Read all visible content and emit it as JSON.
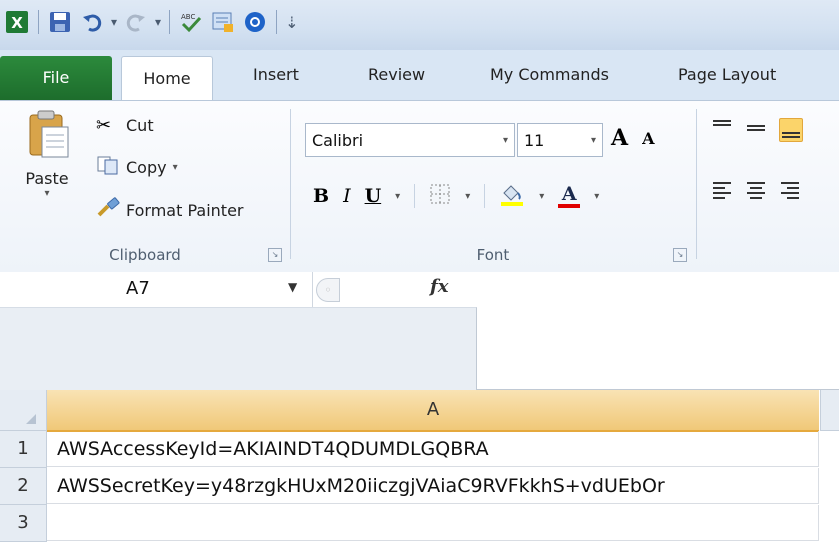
{
  "quick_access": {
    "icons": [
      "excel-icon",
      "save-icon",
      "undo-icon",
      "redo-icon",
      "spelling-icon",
      "form-icon",
      "record-icon",
      "customize-qat-icon"
    ]
  },
  "tabs": [
    "File",
    "Home",
    "Insert",
    "Review",
    "My Commands",
    "Page Layout"
  ],
  "clipboard": {
    "paste_label": "Paste",
    "cut_label": "Cut",
    "copy_label": "Copy",
    "format_painter_label": "Format Painter",
    "group_label": "Clipboard"
  },
  "font": {
    "name": "Calibri",
    "size": "11",
    "grow_label": "A",
    "shrink_label": "A",
    "bold_label": "B",
    "italic_label": "I",
    "underline_label": "U",
    "font_color_label": "A",
    "group_label": "Font",
    "highlight_color": "#ffff00",
    "font_color": "#e00000"
  },
  "formula_bar": {
    "name_box": "A7",
    "fx_label": "fx",
    "content": ""
  },
  "sheet": {
    "column_headers": [
      "A"
    ],
    "rows": [
      {
        "num": "1",
        "a": "AWSAccessKeyId=AKIAINDT4QDUMDLGQBRA"
      },
      {
        "num": "2",
        "a": "AWSSecretKey=y48rzgkHUxM20iiczgjVAiaC9RVFkkhS+vdUEbOr"
      },
      {
        "num": "3",
        "a": ""
      }
    ]
  }
}
